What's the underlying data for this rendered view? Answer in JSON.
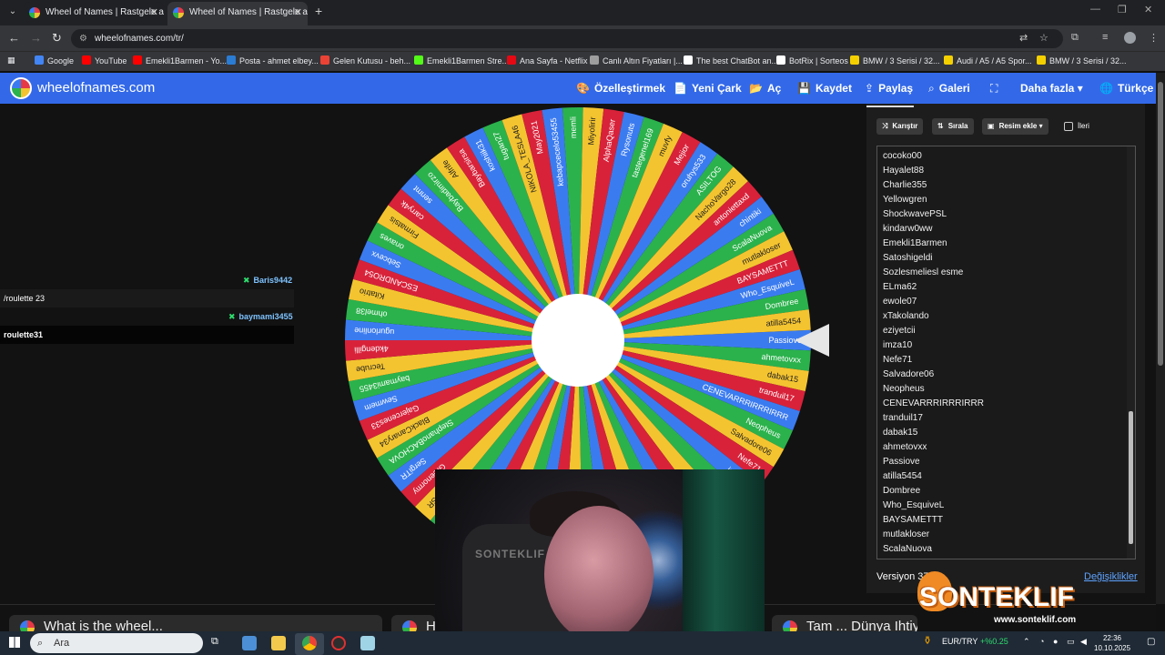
{
  "browser": {
    "tabs": [
      {
        "title": "Wheel of Names | Rastgele ad seçici"
      },
      {
        "title": "Wheel of Names | Rastgele ad seçici"
      }
    ],
    "url": "wheelofnames.com/tr/",
    "bookmarks": [
      {
        "label": "Google",
        "color": "#4285f4"
      },
      {
        "label": "YouTube",
        "color": "#ff0000"
      },
      {
        "label": "Emekli1Barmen - Yo...",
        "color": "#ff0000"
      },
      {
        "label": "Posta - ahmet elbey...",
        "color": "#2b7cd3"
      },
      {
        "label": "Gelen Kutusu - beh...",
        "color": "#ea4335"
      },
      {
        "label": "Emekli1Barmen Stre...",
        "color": "#53fc18"
      },
      {
        "label": "Ana Sayfa - Netflix",
        "color": "#e50914"
      },
      {
        "label": "Canlı Altın Fiyatları |...",
        "color": "#9e9e9e"
      },
      {
        "label": "The best ChatBot an...",
        "color": "#ffffff"
      },
      {
        "label": "BotRix | Sorteos",
        "color": "#ffffff"
      },
      {
        "label": "BMW / 3 Serisi / 32...",
        "color": "#f5d000"
      },
      {
        "label": "Audi / A5 / A5 Spor...",
        "color": "#f5d000"
      },
      {
        "label": "BMW / 3 Serisi / 32...",
        "color": "#f5d000"
      }
    ]
  },
  "site": {
    "brand": "wheelofnames.com",
    "accent": "#3369e8",
    "menu": [
      {
        "label": "Özelleştirmek",
        "icon": "palette-icon",
        "glyph": "🎨"
      },
      {
        "label": "Yeni Çark",
        "icon": "file-icon",
        "glyph": "📄"
      },
      {
        "label": "Aç",
        "icon": "folder-icon",
        "glyph": "📂"
      },
      {
        "label": "Kaydet",
        "icon": "save-icon",
        "glyph": "💾"
      },
      {
        "label": "Paylaş",
        "icon": "share-icon",
        "glyph": "⇪"
      },
      {
        "label": "Galeri",
        "icon": "search-icon",
        "glyph": "⌕"
      },
      {
        "label": "",
        "icon": "fullscreen-icon",
        "glyph": "⛶"
      },
      {
        "label": "Daha fazla ▾",
        "icon": "",
        "glyph": ""
      },
      {
        "label": "Türkçe",
        "icon": "globe-icon",
        "glyph": "🌐"
      }
    ]
  },
  "chat": [
    {
      "user": "Baris9442",
      "message": "/roulette 23",
      "user_color": "#7ec3ff"
    },
    {
      "user": "baymami3455",
      "message": "roulette31",
      "user_color": "#7ec3ff"
    }
  ],
  "panel": {
    "buttons": [
      {
        "label": "Karıştır",
        "icon": "shuffle-icon"
      },
      {
        "label": "Sırala",
        "icon": "sort-icon"
      },
      {
        "label": "Resim ekle ▾",
        "icon": "image-icon"
      }
    ],
    "advanced_label": "İleri",
    "names": [
      "cocoko00",
      "Hayalet88",
      "Charlie355",
      "Yellowgren",
      "ShockwavePSL",
      "kindarw0ww",
      "Emekli1Barmen",
      "Satoshigeldi",
      "Sozlesmeliesl esme",
      "ELma62",
      "ewole07",
      "xTakolando",
      "eziyetcii",
      "imza10",
      "Nefe71",
      "Salvadore06",
      "Neopheus",
      "CENEVARRRIRRRIRRR",
      "tranduil17",
      "dabak15",
      "ahmetovxx",
      "Passiove",
      "atilla5454",
      "Dombree",
      "Who_EsquiveL",
      "BAYSAMETTT",
      "mutlakloser",
      "ScalaNuova",
      "chintiki"
    ],
    "version": "Versiyon 379",
    "changes_link": "Değişiklikler"
  },
  "wheel": {
    "colors": [
      "#3b7bf0",
      "#2bb24c",
      "#f4c430",
      "#d8223a"
    ],
    "labels": [
      "Passiove",
      "ahmetovxx",
      "dabak15",
      "tranduil17",
      "CENEVARRRIRRRIRRR",
      "Neopheus",
      "Salvadore06",
      "Nefe71",
      "imza10",
      "eziyetcii",
      "xTakolando",
      "ewole07",
      "ELma62",
      "Sozlesmeliesl",
      "Satoshigeldi",
      "Emekli1Barmen",
      "kindarw0ww",
      "ShockwavePSL",
      "Yellowgren",
      "Charlie355",
      "Hayalet88",
      "cocoko00",
      "DenizKo",
      "MARVEN",
      "burkanizm",
      "umaer4n",
      "BIBSR",
      "Greenormy",
      "SergiTR",
      "StephanoBACHOVA",
      "BlackCanary34",
      "Gajercenes33",
      "Sewmem",
      "baymami3455",
      "Tecrube",
      "4kdengilli",
      "ugurlonline",
      "ohmel38",
      "Kitatrio",
      "ESCANDRO54",
      "Sebcevx",
      "onaves",
      "Firmatsis",
      "carry4k",
      "senmt",
      "Baybadimirzo",
      "Alfrife",
      "Baybarsirsa",
      "koshiik31",
      "tugan27",
      "NIKOLA_TESLA46",
      "May2021",
      "kebapcecelo53455",
      "memli",
      "Miyolirir",
      "AlphaQaser",
      "Rysonuts",
      "tastegenel169",
      "muvfy",
      "Mejior",
      "oruhys533",
      "ASILTOG",
      "NachoVargo28",
      "antoniettaxd",
      "chintiki",
      "ScalaNuova",
      "mutlakloser",
      "BAYSAMETTT",
      "Who_EsquiveL",
      "Dombree",
      "atilla5454"
    ]
  },
  "overlay": {
    "watermark": "SONTEKLIF",
    "url": "www.sonteklif.com",
    "chair_logo": "SONTEKLIF"
  },
  "below": {
    "cards": [
      "What is the wheel...",
      "H...",
      "Tam ... Dünya Ihtiyac..."
    ]
  },
  "taskbar": {
    "search_placeholder": "Ara",
    "currency": "EUR/TRY",
    "currency_change": "+%0.25",
    "time": "22:36",
    "date": "10.10.2025"
  }
}
